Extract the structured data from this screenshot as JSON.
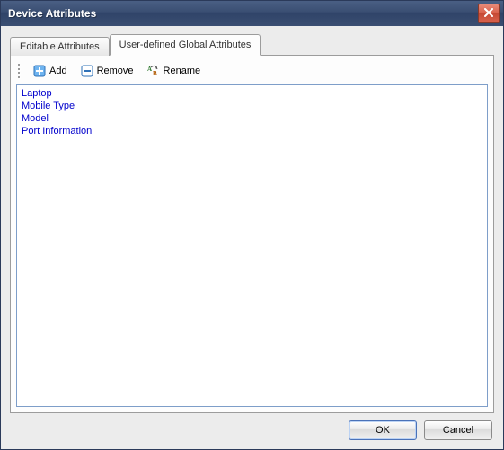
{
  "title": "Device Attributes",
  "tabs": {
    "editable": "Editable Attributes",
    "user_defined": "User-defined Global Attributes"
  },
  "active_tab": "user_defined",
  "toolbar": {
    "add_label": "Add",
    "remove_label": "Remove",
    "rename_label": "Rename"
  },
  "attributes": [
    "Laptop",
    "Mobile Type",
    "Model",
    "Port Information"
  ],
  "buttons": {
    "ok": "OK",
    "cancel": "Cancel"
  }
}
